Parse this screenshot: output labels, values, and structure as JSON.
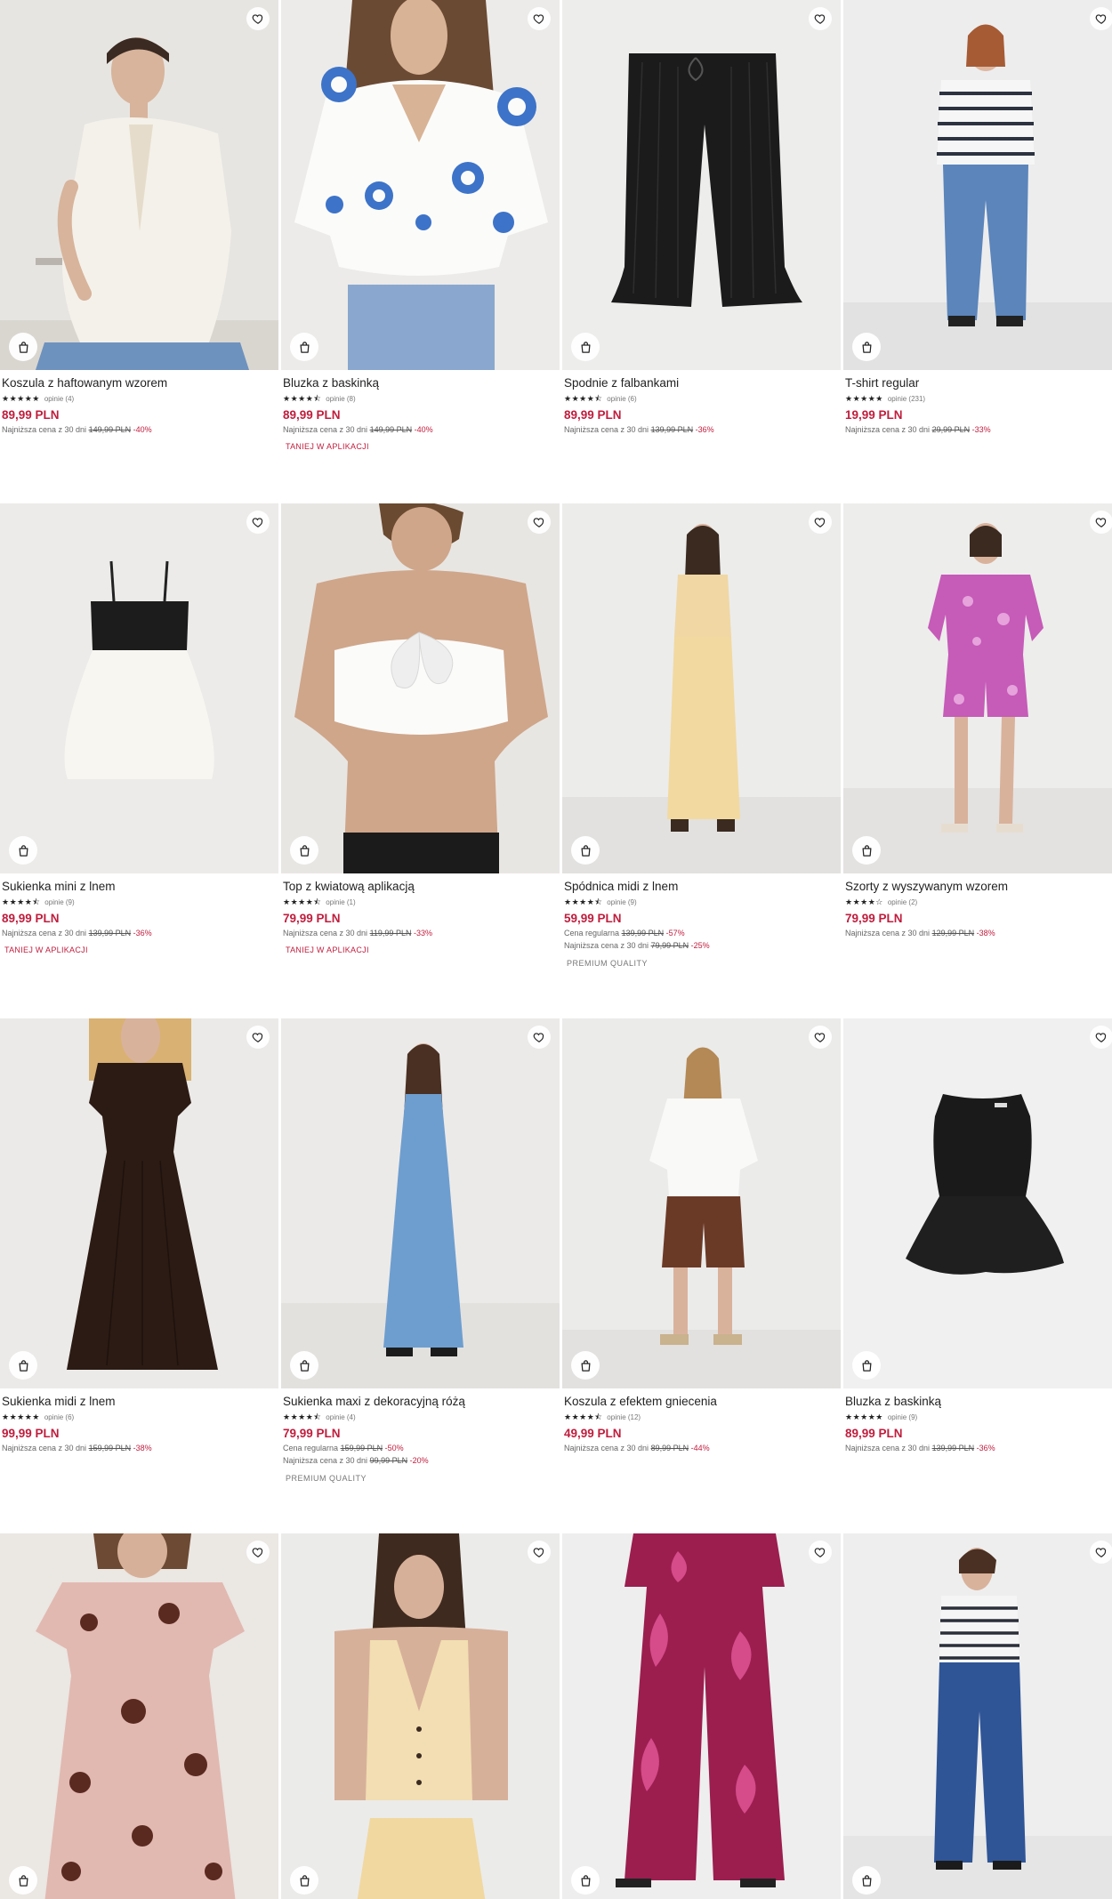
{
  "colors": {
    "price": "#c01d3d",
    "discount": "#c01d3d",
    "promo": "#c01d3d",
    "premium": "#777777"
  },
  "icons": {
    "favorite": "heart-outline-icon",
    "add_to_cart": "shopping-bag-icon"
  },
  "products": [
    {
      "title": "Koszula z haftowanym wzorem",
      "stars": "★★★★★",
      "reviews": "opinie (4)",
      "price": "89,99 PLN",
      "lowest_label": "Najniższa cena z 30 dni",
      "lowest_price": "149,99 PLN",
      "lowest_discount": "-40%"
    },
    {
      "title": "Bluzka z baskinką",
      "stars": "★★★★⯪",
      "reviews": "opinie (8)",
      "price": "89,99 PLN",
      "lowest_label": "Najniższa cena z 30 dni",
      "lowest_price": "149,99 PLN",
      "lowest_discount": "-40%",
      "promo": "TANIEJ W APLIKACJI"
    },
    {
      "title": "Spodnie z falbankami",
      "stars": "★★★★⯪",
      "reviews": "opinie (6)",
      "price": "89,99 PLN",
      "lowest_label": "Najniższa cena z 30 dni",
      "lowest_price": "139,99 PLN",
      "lowest_discount": "-36%"
    },
    {
      "title": "T-shirt regular",
      "stars": "★★★★★",
      "reviews": "opinie (231)",
      "price": "19,99 PLN",
      "lowest_label": "Najniższa cena z 30 dni",
      "lowest_price": "29,99 PLN",
      "lowest_discount": "-33%"
    },
    {
      "title": "Sukienka mini z lnem",
      "stars": "★★★★⯪",
      "reviews": "opinie (9)",
      "price": "89,99 PLN",
      "lowest_label": "Najniższa cena z 30 dni",
      "lowest_price": "139,99 PLN",
      "lowest_discount": "-36%",
      "promo": "TANIEJ W APLIKACJI"
    },
    {
      "title": "Top z kwiatową aplikacją",
      "stars": "★★★★⯪",
      "reviews": "opinie (1)",
      "price": "79,99 PLN",
      "lowest_label": "Najniższa cena z 30 dni",
      "lowest_price": "119,99 PLN",
      "lowest_discount": "-33%",
      "promo": "TANIEJ W APLIKACJI"
    },
    {
      "title": "Spódnica midi z lnem",
      "stars": "★★★★⯪",
      "reviews": "opinie (9)",
      "price": "59,99 PLN",
      "regular_label": "Cena regularna",
      "regular_price": "139,99 PLN",
      "regular_discount": "-57%",
      "lowest_label": "Najniższa cena z 30 dni",
      "lowest_price": "79,99 PLN",
      "lowest_discount": "-25%",
      "premium": "PREMIUM QUALITY"
    },
    {
      "title": "Szorty z wyszywanym wzorem",
      "stars": "★★★★☆",
      "reviews": "opinie (2)",
      "price": "79,99 PLN",
      "lowest_label": "Najniższa cena z 30 dni",
      "lowest_price": "129,99 PLN",
      "lowest_discount": "-38%"
    },
    {
      "title": "Sukienka midi z lnem",
      "stars": "★★★★★",
      "reviews": "opinie (6)",
      "price": "99,99 PLN",
      "lowest_label": "Najniższa cena z 30 dni",
      "lowest_price": "159,99 PLN",
      "lowest_discount": "-38%"
    },
    {
      "title": "Sukienka maxi z dekoracyjną różą",
      "stars": "★★★★⯪",
      "reviews": "opinie (4)",
      "price": "79,99 PLN",
      "regular_label": "Cena regularna",
      "regular_price": "159,99 PLN",
      "regular_discount": "-50%",
      "lowest_label": "Najniższa cena z 30 dni",
      "lowest_price": "99,99 PLN",
      "lowest_discount": "-20%",
      "premium": "PREMIUM QUALITY"
    },
    {
      "title": "Koszula z efektem gniecenia",
      "stars": "★★★★⯪",
      "reviews": "opinie (12)",
      "price": "49,99 PLN",
      "lowest_label": "Najniższa cena z 30 dni",
      "lowest_price": "89,99 PLN",
      "lowest_discount": "-44%"
    },
    {
      "title": "Bluzka z baskinką",
      "stars": "★★★★★",
      "reviews": "opinie (9)",
      "price": "89,99 PLN",
      "lowest_label": "Najniższa cena z 30 dni",
      "lowest_price": "139,99 PLN",
      "lowest_discount": "-36%"
    },
    {
      "title": ""
    },
    {
      "title": ""
    },
    {
      "title": ""
    },
    {
      "title": ""
    }
  ]
}
